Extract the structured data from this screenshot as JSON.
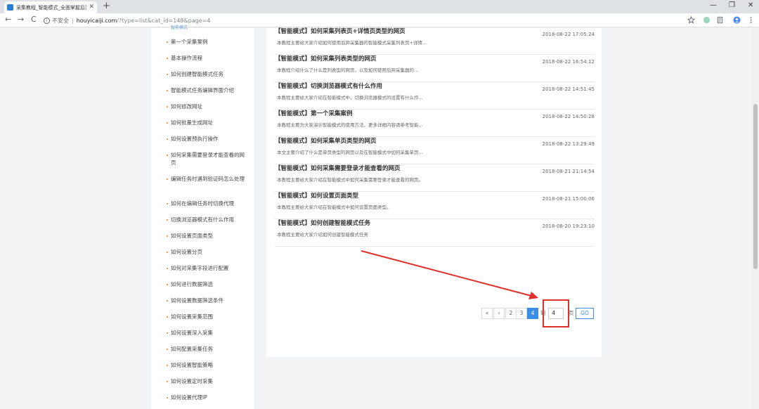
{
  "browser": {
    "tab_title": "采集教程_智能模式_全面掌握后羿...",
    "tab_close": "✕",
    "new_tab": "+",
    "window_controls": [
      "—",
      "❐",
      "✕"
    ],
    "nav": {
      "back": "←",
      "forward": "→",
      "reload": "C"
    },
    "security_icon": "i",
    "security_label": "不安全",
    "url_separator": "|",
    "url_host": "houyicaiji.com",
    "url_path": "/?type=list&cat_id=148&page=4",
    "icons": [
      "star-icon",
      "extension-icon",
      "reader-icon",
      "profile-icon",
      "menu-icon"
    ]
  },
  "sidebar": {
    "top_label": "智能模式",
    "items": [
      "第一个采集案例",
      "基本操作流程",
      "如何创建智能模式任务",
      "智能模式任务编辑界面介绍",
      "如何修改网址",
      "如何批量生成网址",
      "如何设置预执行操作",
      "如何采集需要登录才能查看的网页",
      "编辑任务时遇到验证码怎么处理",
      "如何在编辑任务时切换代理",
      "切换浏览器模式有什么作用",
      "如何设置页面类型",
      "如何设置分页",
      "如何对采集字段进行配置",
      "如何进行数据筛选",
      "如何设置数据筛选条件",
      "如何设置采集范围",
      "如何设置深入采集",
      "如何配置采集任务",
      "如何设置智能策略",
      "如何设置定时采集",
      "如何设置代理IP"
    ]
  },
  "articles": [
    {
      "title": "【智能模式】如何采集列表页+详情页类型的网页",
      "desc": "本教程主要给大家介绍如何使用后羿采集器的智能模式采集列表页+详情...",
      "date": "2018-08-22 17:05:24"
    },
    {
      "title": "【智能模式】如何采集列表类型的网页",
      "desc": "本教程介绍什么了什么是列表型的网页，以及如何使用后羿采集器的...",
      "date": "2018-08-22 16:54:12"
    },
    {
      "title": "【智能模式】切换浏览器模式有什么作用",
      "desc": "本教程主要给大家介绍在智能模式中，切换浏览器模式的设置有什么作...",
      "date": "2018-08-22 14:51:45"
    },
    {
      "title": "【智能模式】第一个采集案例",
      "desc": "本教程主要为大家演示智能模式的使用方法，更多详细内容请参考智能...",
      "date": "2018-08-22 14:50:28"
    },
    {
      "title": "【智能模式】如何采集单页类型的网页",
      "desc": "本文主要介绍了什么是单页类型的网页以及在智能模式中如何采集单页...",
      "date": "2018-08-22 13:29:49"
    },
    {
      "title": "【智能模式】如何采集需要登录才能查看的网页",
      "desc": "本教程主要给大家介绍在智能模式中如何采集需要登录才能查看的网页。",
      "date": "2018-08-21 21:14:54"
    },
    {
      "title": "【智能模式】如何设置页面类型",
      "desc": "本教程主要给大家介绍在智能模式中如何设置页面类型。",
      "date": "2018-08-21 15:00:06"
    },
    {
      "title": "【智能模式】如何创建智能模式任务",
      "desc": "本教程主要给大家介绍如何创建智能模式任务",
      "date": "2018-08-20 19:23:10"
    }
  ],
  "pagination": {
    "first": "«",
    "prev": "‹",
    "pages": [
      "2",
      "3",
      "4"
    ],
    "current": "4",
    "to_label": "到",
    "input_value": "4",
    "page_label": "页",
    "go_label": "GO"
  },
  "colors": {
    "accent": "#3a8ee6",
    "annotation": "#e0302a",
    "bullet": "#e87b24"
  }
}
